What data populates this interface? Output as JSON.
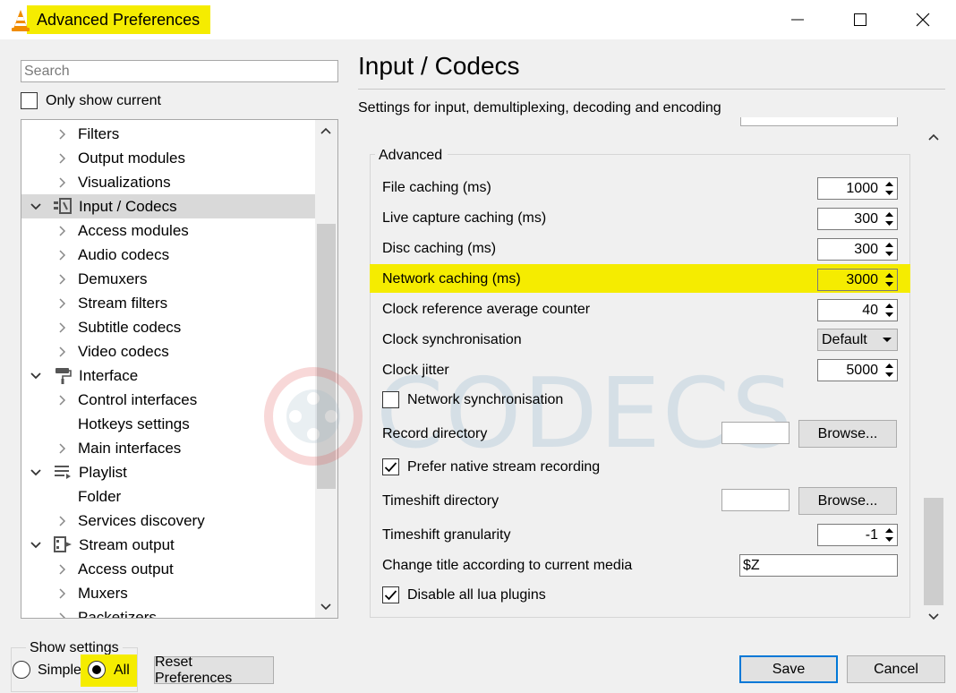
{
  "window": {
    "title": "Advanced Preferences"
  },
  "sidebar": {
    "search_placeholder": "Search",
    "only_show_current": "Only show current",
    "tree": [
      {
        "label": "Filters",
        "level": 1,
        "expanded": false,
        "has_children": true,
        "icon": ""
      },
      {
        "label": "Output modules",
        "level": 1,
        "expanded": false,
        "has_children": true,
        "icon": ""
      },
      {
        "label": "Visualizations",
        "level": 1,
        "expanded": false,
        "has_children": true,
        "icon": ""
      },
      {
        "label": "Input / Codecs",
        "level": 0,
        "expanded": true,
        "has_children": true,
        "icon": "codec-icon",
        "selected": true
      },
      {
        "label": "Access modules",
        "level": 1,
        "expanded": false,
        "has_children": true,
        "icon": ""
      },
      {
        "label": "Audio codecs",
        "level": 1,
        "expanded": false,
        "has_children": true,
        "icon": ""
      },
      {
        "label": "Demuxers",
        "level": 1,
        "expanded": false,
        "has_children": true,
        "icon": ""
      },
      {
        "label": "Stream filters",
        "level": 1,
        "expanded": false,
        "has_children": true,
        "icon": ""
      },
      {
        "label": "Subtitle codecs",
        "level": 1,
        "expanded": false,
        "has_children": true,
        "icon": ""
      },
      {
        "label": "Video codecs",
        "level": 1,
        "expanded": false,
        "has_children": true,
        "icon": ""
      },
      {
        "label": "Interface",
        "level": 0,
        "expanded": true,
        "has_children": true,
        "icon": "paint-roller-icon"
      },
      {
        "label": "Control interfaces",
        "level": 1,
        "expanded": false,
        "has_children": true,
        "icon": ""
      },
      {
        "label": "Hotkeys settings",
        "level": 1,
        "expanded": false,
        "has_children": false,
        "icon": ""
      },
      {
        "label": "Main interfaces",
        "level": 1,
        "expanded": false,
        "has_children": true,
        "icon": ""
      },
      {
        "label": "Playlist",
        "level": 0,
        "expanded": true,
        "has_children": true,
        "icon": "playlist-icon"
      },
      {
        "label": "Folder",
        "level": 1,
        "expanded": false,
        "has_children": false,
        "icon": ""
      },
      {
        "label": "Services discovery",
        "level": 1,
        "expanded": false,
        "has_children": true,
        "icon": ""
      },
      {
        "label": "Stream output",
        "level": 0,
        "expanded": true,
        "has_children": true,
        "icon": "stream-output-icon"
      },
      {
        "label": "Access output",
        "level": 1,
        "expanded": false,
        "has_children": true,
        "icon": ""
      },
      {
        "label": "Muxers",
        "level": 1,
        "expanded": false,
        "has_children": true,
        "icon": ""
      },
      {
        "label": "Packetizers",
        "level": 1,
        "expanded": false,
        "has_children": true,
        "icon": ""
      }
    ]
  },
  "main": {
    "title": "Input / Codecs",
    "subtitle": "Settings for input, demultiplexing, decoding and encoding",
    "group_title": "Advanced",
    "settings": {
      "file_caching": {
        "label": "File caching (ms)",
        "value": "1000"
      },
      "live_capture_caching": {
        "label": "Live capture caching (ms)",
        "value": "300"
      },
      "disc_caching": {
        "label": "Disc caching (ms)",
        "value": "300"
      },
      "network_caching": {
        "label": "Network caching (ms)",
        "value": "3000"
      },
      "clock_ref_avg_counter": {
        "label": "Clock reference average counter",
        "value": "40"
      },
      "clock_sync": {
        "label": "Clock synchronisation",
        "value": "Default"
      },
      "clock_jitter": {
        "label": "Clock jitter",
        "value": "5000"
      },
      "network_sync": {
        "label": "Network synchronisation",
        "checked": false
      },
      "record_directory": {
        "label": "Record directory",
        "value": "",
        "browse": "Browse..."
      },
      "prefer_native_recording": {
        "label": "Prefer native stream recording",
        "checked": true
      },
      "timeshift_directory": {
        "label": "Timeshift directory",
        "value": "",
        "browse": "Browse..."
      },
      "timeshift_granularity": {
        "label": "Timeshift granularity",
        "value": "-1"
      },
      "change_title": {
        "label": "Change title according to current media",
        "value": "$Z"
      },
      "disable_lua": {
        "label": "Disable all lua plugins",
        "checked": true
      }
    }
  },
  "watermark": {
    "text": "CODECS"
  },
  "footer": {
    "show_settings_label": "Show settings",
    "simple_label": "Simple",
    "all_label": "All",
    "selected": "All",
    "reset_label": "Reset Preferences",
    "save_label": "Save",
    "cancel_label": "Cancel"
  },
  "colors": {
    "highlight": "#f5ec00",
    "accent": "#0078d7",
    "vlc_orange": "#f08c00"
  }
}
